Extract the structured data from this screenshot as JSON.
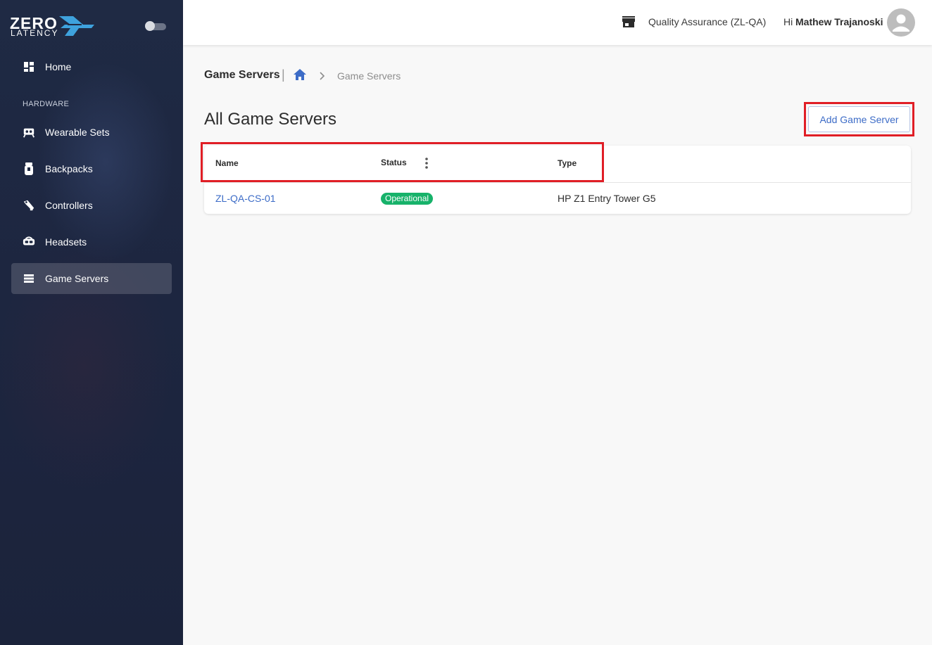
{
  "brand": {
    "logo_top": "ZERO",
    "logo_bottom": "LATENCY",
    "accent": "#3ea2dd"
  },
  "sidebar": {
    "items": [
      {
        "label": "Home",
        "icon": "dashboard-icon"
      },
      {
        "label": "Wearable Sets",
        "icon": "wearable-set-icon"
      },
      {
        "label": "Backpacks",
        "icon": "backpack-icon"
      },
      {
        "label": "Controllers",
        "icon": "controller-icon"
      },
      {
        "label": "Headsets",
        "icon": "headset-icon"
      },
      {
        "label": "Game Servers",
        "icon": "server-icon",
        "active": true
      }
    ],
    "section_label": "HARDWARE"
  },
  "header": {
    "org_name": "Quality Assurance (ZL-QA)",
    "greeting": "Hi",
    "user_name": "Mathew Trajanoski"
  },
  "breadcrumb": {
    "title": "Game Servers",
    "separator": "|",
    "current": "Game Servers"
  },
  "page": {
    "title": "All Game Servers",
    "add_button_label": "Add Game Server"
  },
  "table": {
    "headers": [
      "Name",
      "Status",
      "Type"
    ],
    "rows": [
      {
        "name": "ZL-QA-CS-01",
        "status": "Operational",
        "type": "HP Z1 Entry Tower G5"
      }
    ]
  },
  "colors": {
    "sidebar_bg": "#1f2a44",
    "link": "#3d6cc7",
    "status_operational": "#17b26a",
    "highlight": "#e01e26"
  }
}
